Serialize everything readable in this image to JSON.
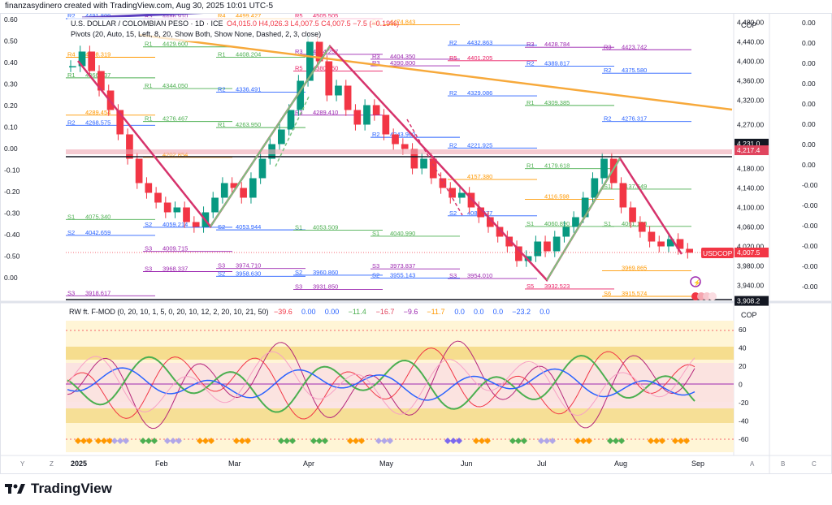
{
  "attribution": "finanzasydinero created with TradingView.com, Aug 30, 2025 10:01 UTC-5",
  "legend": {
    "symbol": "U.S. DOLLAR / COLOMBIAN PESO · 1D · ICE",
    "ohlc": "O4,015.0 H4,026.3 L4,007.5 C4,007.5 −7.5 (−0.19%)",
    "pivots": "Pivots (20, Auto, 15, Left, 8, 20, Show Both, Show None, Dashed, 2, 3, close)"
  },
  "currency_label": "COP",
  "price_axis_ticks": [
    "4,480.00",
    "4,440.00",
    "4,400.00",
    "4,360.00",
    "4,320.00",
    "4,270.00",
    "4,180.00",
    "4,140.00",
    "4,100.00",
    "4,060.00",
    "4,020.00",
    "3,980.00",
    "3,940.00"
  ],
  "price_badges": [
    {
      "text": "4,231.0",
      "color": "#131722"
    },
    {
      "text": "4,217.4",
      "color": "#e0445e"
    },
    {
      "text": "4,007.5",
      "color": "#f23645"
    },
    {
      "text": "3,908.2",
      "color": "#131722"
    }
  ],
  "symbol_badge": "USDCOP",
  "left_axis_ticks": [
    "0.60",
    "0.50",
    "0.40",
    "0.30",
    "0.20",
    "0.10",
    "0.00",
    "-0.10",
    "-0.20",
    "-0.30",
    "-0.40",
    "-0.50",
    "0.00"
  ],
  "far_right_ticks": [
    "0.00",
    "0.00",
    "0.00",
    "0.00",
    "0.00",
    "0.00",
    "0.00",
    "0.00",
    "-0.00",
    "-0.00",
    "-0.00",
    "-0.00",
    "-0.00",
    "-0.00"
  ],
  "pivot_labels": [
    {
      "level": "R2",
      "price": "4491.809"
    },
    {
      "level": "R3",
      "price": "4486.910"
    },
    {
      "level": "R4",
      "price": "4499.427"
    },
    {
      "level": "R5",
      "price": "4505.505"
    },
    {
      "level": "R4",
      "price": "4474.843"
    },
    {
      "level": "R2",
      "price": "4432.863"
    },
    {
      "level": "R3",
      "price": "4428.784"
    },
    {
      "level": "R3",
      "price": "4423.742"
    },
    {
      "level": "R4",
      "price": "4408.319"
    },
    {
      "level": "R1",
      "price": "4429.600"
    },
    {
      "level": "R1",
      "price": "4408.204"
    },
    {
      "level": "R3",
      "price": "4414.257"
    },
    {
      "level": "R3",
      "price": "4404.350"
    },
    {
      "level": "R5",
      "price": "4401.205"
    },
    {
      "level": "R2",
      "price": "4389.817"
    },
    {
      "level": "R2",
      "price": "4375.580"
    },
    {
      "level": "R1",
      "price": "4366.037"
    },
    {
      "level": "R1",
      "price": "4344.050"
    },
    {
      "level": "R2",
      "price": "4336.491"
    },
    {
      "level": "R5",
      "price": "4380.050"
    },
    {
      "level": "R3",
      "price": "4390.800"
    },
    {
      "level": "R2",
      "price": "4329.086"
    },
    {
      "level": "R1",
      "price": "4309.385"
    },
    {
      "level": "R2",
      "price": "4276.317"
    },
    {
      "level": "R2",
      "price": "4268.575"
    },
    {
      "level": "R1",
      "price": "4276.467"
    },
    {
      "level": "R1",
      "price": "4263.950"
    },
    {
      "level": "R3",
      "price": "4289.410"
    },
    {
      "level": "R2",
      "price": "4243.960"
    },
    {
      "level": "R2",
      "price": "4221.925"
    },
    {
      "level": "R1",
      "price": "4179.618"
    },
    {
      "level": "S1",
      "price": "4137.549"
    },
    {
      "level": "S1",
      "price": "4075.340"
    },
    {
      "level": "S2",
      "price": "4059.214"
    },
    {
      "level": "S2",
      "price": "4053.944"
    },
    {
      "level": "S1",
      "price": "4053.509"
    },
    {
      "level": "S1",
      "price": "4040.990"
    },
    {
      "level": "S2",
      "price": "4082.877"
    },
    {
      "level": "S1",
      "price": "4060.890"
    },
    {
      "level": "S1",
      "price": "4061.180"
    },
    {
      "level": "S2",
      "price": "4042.659"
    },
    {
      "level": "S3",
      "price": "4009.715"
    },
    {
      "level": "S3",
      "price": "3974.710"
    },
    {
      "level": "S2",
      "price": "3960.860"
    },
    {
      "level": "S3",
      "price": "3973.837"
    },
    {
      "level": "S3",
      "price": "3954.010"
    },
    {
      "level": "S5",
      "price": "3932.523"
    },
    {
      "level": "S6",
      "price": "3915.574"
    },
    {
      "level": "S3",
      "price": "3918.617"
    },
    {
      "level": "S3",
      "price": "3968.337"
    },
    {
      "level": "S2",
      "price": "3958.630"
    },
    {
      "level": "S3",
      "price": "3931.850"
    },
    {
      "level": "S2",
      "price": "3955.143"
    },
    {
      "level": "",
      "price": "4157.380"
    },
    {
      "level": "",
      "price": "4116.598"
    },
    {
      "level": "",
      "price": "3969.865"
    },
    {
      "level": "",
      "price": "4289.454"
    },
    {
      "level": "",
      "price": "4202.854"
    }
  ],
  "indicator": {
    "title": "RW ft. F-MOD (0, 20, 10, 1, 5, 0, 20, 10, 12, 2, 20, 10, 21, 50)",
    "values": [
      {
        "text": "−39.6",
        "color": "#f23645"
      },
      {
        "text": "0.00",
        "color": "#2962ff"
      },
      {
        "text": "0.00",
        "color": "#2962ff"
      },
      {
        "text": "−11.4",
        "color": "#4caf50"
      },
      {
        "text": "−16.7",
        "color": "#e0445e"
      },
      {
        "text": "−9.6",
        "color": "#9c27b0"
      },
      {
        "text": "−11.7",
        "color": "#ff9800"
      },
      {
        "text": "0.0",
        "color": "#2962ff"
      },
      {
        "text": "0.0",
        "color": "#2962ff"
      },
      {
        "text": "0.0",
        "color": "#2962ff"
      },
      {
        "text": "−23.2",
        "color": "#2962ff"
      },
      {
        "text": "0.0",
        "color": "#2962ff"
      }
    ],
    "currency": "COP",
    "ticks": [
      "60",
      "40",
      "20",
      "0",
      "-20",
      "-40",
      "-60"
    ]
  },
  "time_axis": [
    "2025",
    "Feb",
    "Mar",
    "Apr",
    "May",
    "Jun",
    "Jul",
    "Aug",
    "Sep"
  ],
  "bottom_letters": [
    "Y",
    "Z",
    "A",
    "B",
    "C"
  ],
  "logo_text": "TradingView",
  "colors": {
    "up": "#089981",
    "down": "#f23645",
    "zigzag_up": "#7cc47f",
    "zigzag_down": "#d6336c",
    "trend": "#f7a93b"
  }
}
